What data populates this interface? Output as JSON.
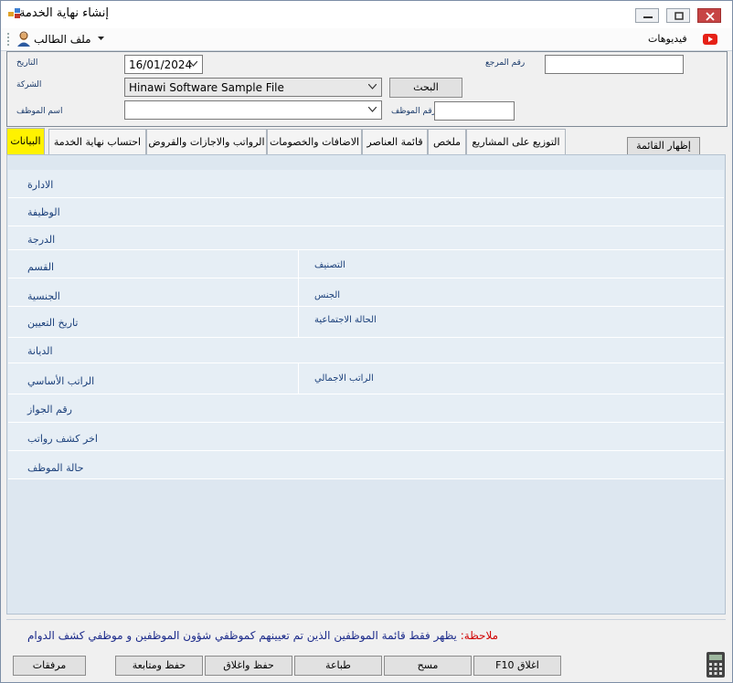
{
  "window": {
    "title": "إنشاء نهاية الخدمة"
  },
  "menubar": {
    "student_file": "ملف الطالب",
    "videos": "فيديوهات"
  },
  "header": {
    "date_label": "التاريخ",
    "date_value": "16/01/2024",
    "ref_label": "رقم المرجع",
    "ref_value": "",
    "company_label": "الشركة",
    "company_value": "Hinawi Software Sample File",
    "search_button": "البحث",
    "emp_name_label": "اسم الموظف",
    "emp_name_value": "",
    "emp_no_label": "رقم الموظف",
    "emp_no_value": ""
  },
  "tabs": [
    {
      "label": "البيانات",
      "active": true
    },
    {
      "label": "احتساب نهاية الخدمة"
    },
    {
      "label": "الرواتب والاجازات والقروض"
    },
    {
      "label": "الاضافات والخصومات"
    },
    {
      "label": "قائمة العناصر"
    },
    {
      "label": "ملخص"
    },
    {
      "label": "التوزيع على المشاريع"
    }
  ],
  "show_list_button": "إظهار القائمة",
  "fields": {
    "department": "الادارة",
    "job": "الوظيفة",
    "grade": "الدرجة",
    "section": "القسم",
    "classification": "التصنيف",
    "nationality": "الجنسية",
    "gender": "الجنس",
    "hire_date": "تاريخ التعيين",
    "marital_status": "الحالة الاجتماعية",
    "religion": "الديانة",
    "basic_salary": "الراتب الأساسي",
    "total_salary": "الراتب الاجمالي",
    "passport_no": "رقم الجواز",
    "last_payslip": "اخر كشف رواتب",
    "employee_status": "حالة الموظف"
  },
  "note": {
    "prefix": "ملاحظة:",
    "text": "يظهر فقط قائمة الموظفين الذين تم تعيينهم كموظفي شؤون الموظفين و موظفي كشف الدوام"
  },
  "footer": {
    "attachments": "مرفقات",
    "save_continue": "حفظ ومتابعة",
    "save_close": "حفظ واغلاق",
    "print": "طباعة",
    "clear": "مسح",
    "close": "F10 اغلاق"
  },
  "colors": {
    "active_tab": "#fff200",
    "note_prefix": "#d00000",
    "note_text": "#1b2a8a",
    "field_label": "#1a3f7a"
  }
}
